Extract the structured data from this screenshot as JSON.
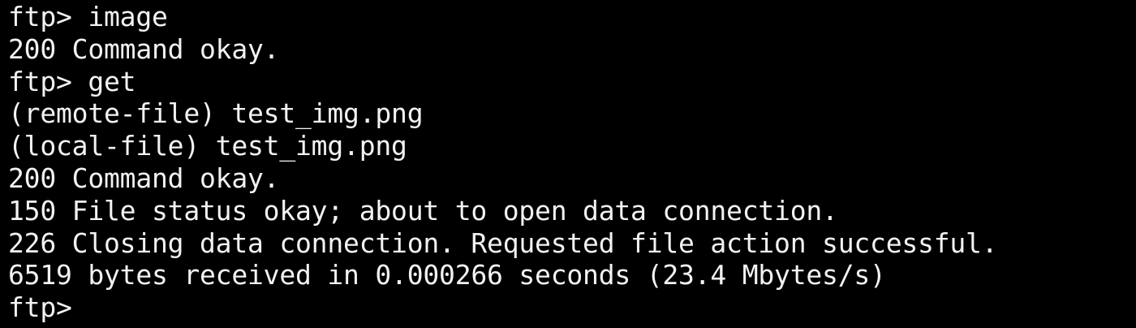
{
  "terminal": {
    "background": "#000000",
    "foreground": "#f2f2f2",
    "lines": [
      "ftp> image",
      "200 Command okay.",
      "ftp> get",
      "(remote-file) test_img.png",
      "(local-file) test_img.png",
      "200 Command okay.",
      "150 File status okay; about to open data connection.",
      "226 Closing data connection. Requested file action successful.",
      "6519 bytes received in 0.000266 seconds (23.4 Mbytes/s)"
    ],
    "prompt": "ftp>"
  }
}
